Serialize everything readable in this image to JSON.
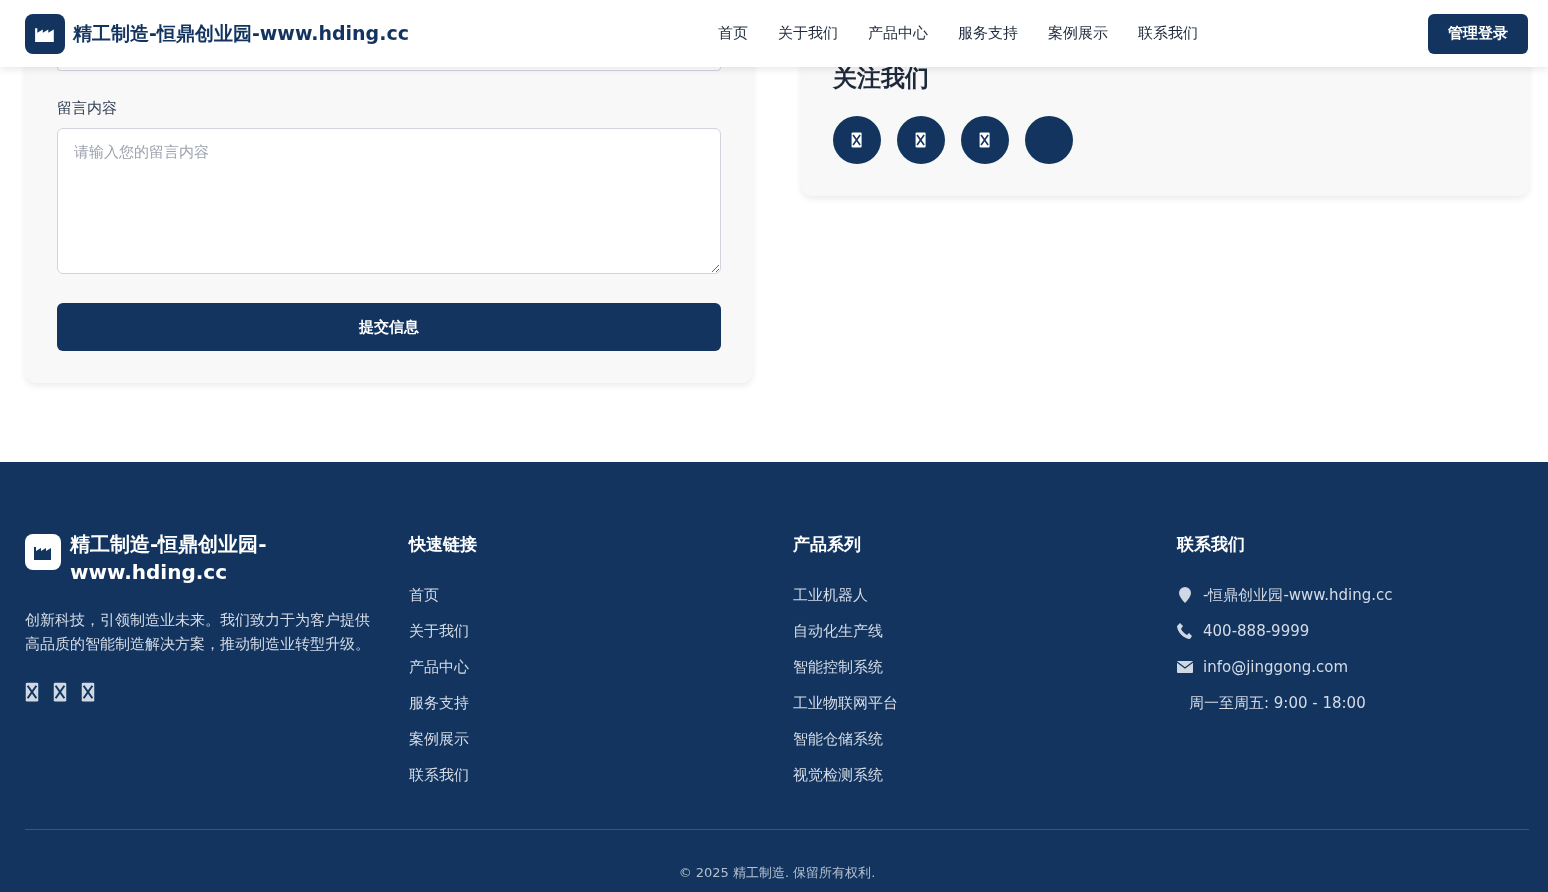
{
  "header": {
    "title": "精工制造-恒鼎创业园-www.hding.cc",
    "nav": [
      {
        "label": "首页",
        "selected": false
      },
      {
        "label": "关于我们",
        "selected": false
      },
      {
        "label": "产品中心",
        "selected": false
      },
      {
        "label": "服务支持",
        "selected": false
      },
      {
        "label": "案例展示",
        "selected": false
      },
      {
        "label": "联系我们",
        "selected": false
      }
    ],
    "login_button": "管理登录"
  },
  "form": {
    "message_label": "留言内容",
    "message_placeholder": "请输入您的留言内容",
    "submit_button": "提交信息"
  },
  "follow": {
    "title": "关注我们",
    "social": [
      {
        "kind": "glyph"
      },
      {
        "kind": "glyph"
      },
      {
        "kind": "glyph"
      },
      {
        "kind": "blank"
      }
    ]
  },
  "footer": {
    "brand": {
      "title": "精工制造-恒鼎创业园-www.hding.cc",
      "description": "创新科技，引领制造业未来。我们致力于为客户提供高品质的智能制造解决方案，推动制造业转型升级。",
      "social": [
        {
          "kind": "glyph"
        },
        {
          "kind": "glyph"
        },
        {
          "kind": "glyph"
        }
      ]
    },
    "quick_links": {
      "title": "快速链接",
      "items": [
        "首页",
        "关于我们",
        "产品中心",
        "服务支持",
        "案例展示",
        "联系我们"
      ]
    },
    "products": {
      "title": "产品系列",
      "items": [
        "工业机器人",
        "自动化生产线",
        "智能控制系统",
        "工业物联网平台",
        "智能仓储系统",
        "视觉检测系统"
      ]
    },
    "contact": {
      "title": "联系我们",
      "items": [
        {
          "kind": "address",
          "text": "-恒鼎创业园-www.hding.cc"
        },
        {
          "kind": "phone",
          "text": "400-888-9999"
        },
        {
          "kind": "email",
          "text": "info@jinggong.com"
        },
        {
          "kind": "hours",
          "text": "周一至周五: 9:00 - 18:00"
        }
      ]
    },
    "copyright": "© 2025 精工制造. 保留所有权利."
  }
}
